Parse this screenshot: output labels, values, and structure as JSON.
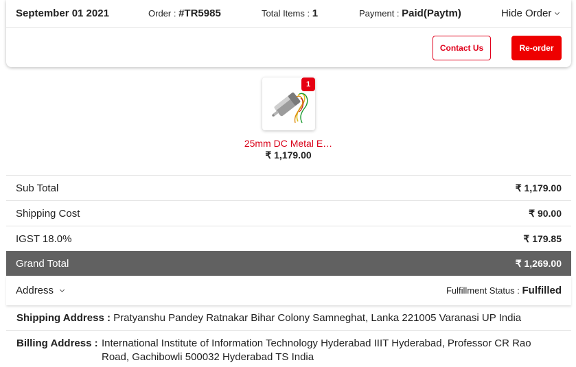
{
  "header": {
    "date": "September 01 2021",
    "order_label": "Order : ",
    "order_value": "#TR5985",
    "items_label": "Total Items : ",
    "items_value": "1",
    "payment_label": "Payment : ",
    "payment_value": "Paid(Paytm)",
    "hide_order": "Hide Order"
  },
  "actions": {
    "contact": "Contact Us",
    "reorder": "Re-order"
  },
  "product": {
    "name": "25mm DC Metal E…",
    "price": "₹ 1,179.00",
    "quantity": "1"
  },
  "summary": [
    {
      "label": "Sub Total",
      "value": "₹ 1,179.00"
    },
    {
      "label": "Shipping Cost",
      "value": "₹ 90.00"
    },
    {
      "label": "IGST 18.0%",
      "value": "₹ 179.85"
    }
  ],
  "grand_total": {
    "label": "Grand Total",
    "value": "₹ 1,269.00"
  },
  "address": {
    "toggle": "Address",
    "fulfillment_label": "Fulfillment Status : ",
    "fulfillment_value": "Fulfilled",
    "shipping_label": "Shipping Address : ",
    "shipping_text": "Pratyanshu Pandey Ratnakar Bihar Colony Samneghat, Lanka 221005 Varanasi UP India",
    "billing_label": "Billing Address : ",
    "billing_text": "International Institute of Information Technology Hyderabad IIIT Hyderabad, Professor CR Rao Road, Gachibowli 500032 Hyderabad TS India"
  },
  "colors": {
    "accent": "#ee0000",
    "grand_bg": "#616161"
  },
  "icons": [
    "chevron-down-icon",
    "motor-product-image"
  ]
}
